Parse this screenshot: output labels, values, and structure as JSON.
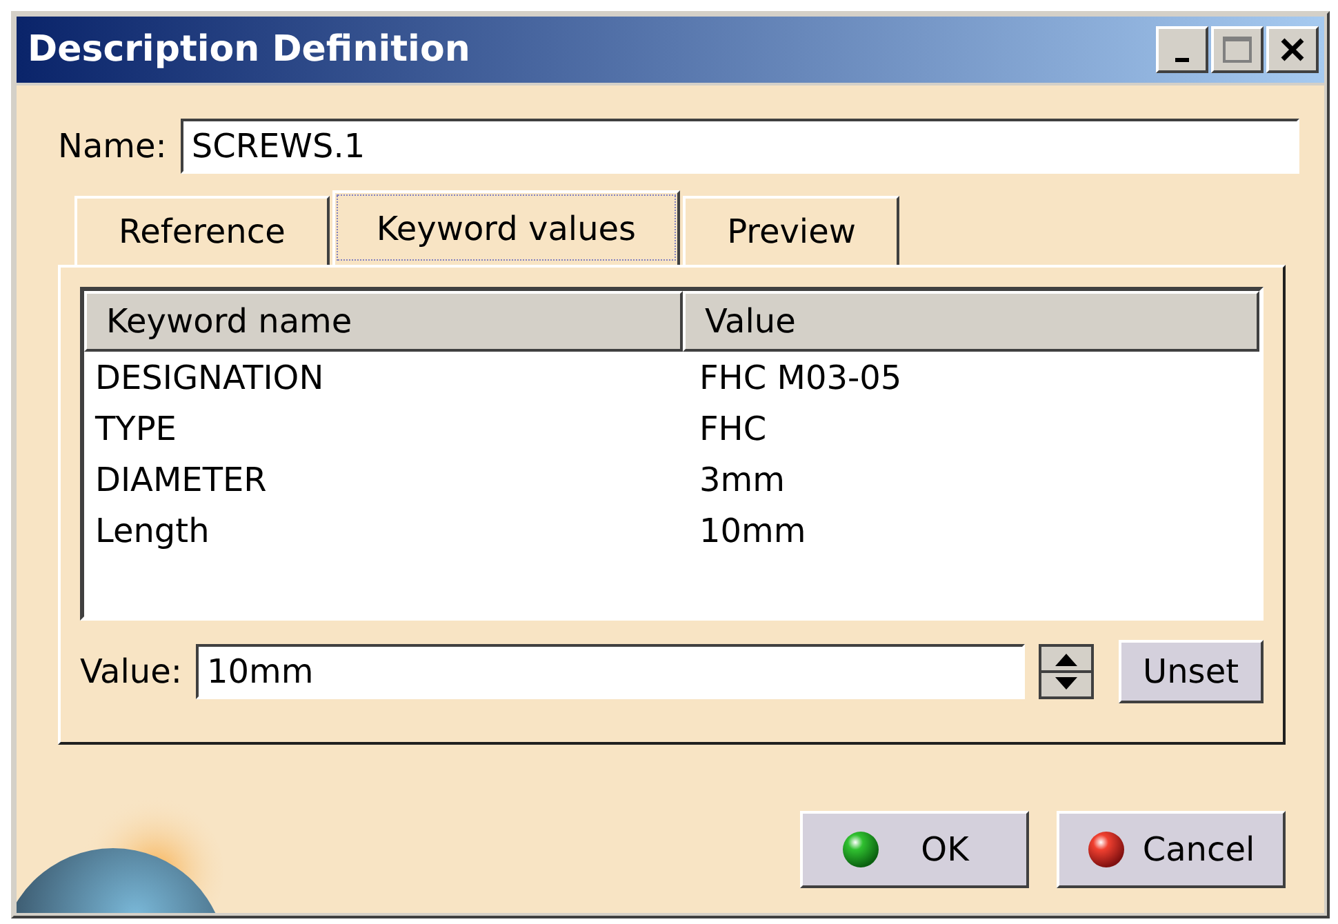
{
  "window": {
    "title": "Description Definition"
  },
  "name_field": {
    "label": "Name:",
    "value": "SCREWS.1"
  },
  "tabs": [
    {
      "label": "Reference",
      "selected": false
    },
    {
      "label": "Keyword values",
      "selected": true
    },
    {
      "label": "Preview",
      "selected": false
    }
  ],
  "table": {
    "columns": [
      "Keyword name",
      "Value"
    ],
    "rows": [
      [
        "DESIGNATION",
        "FHC M03-05"
      ],
      [
        "TYPE",
        "FHC"
      ],
      [
        "DIAMETER",
        "3mm"
      ],
      [
        "Length",
        "10mm"
      ]
    ]
  },
  "value_field": {
    "label": "Value:",
    "value": "10mm"
  },
  "unset_button": "Unset",
  "buttons": [
    {
      "label": "OK",
      "kind": "ok"
    },
    {
      "label": "Cancel",
      "kind": "cancel"
    }
  ]
}
